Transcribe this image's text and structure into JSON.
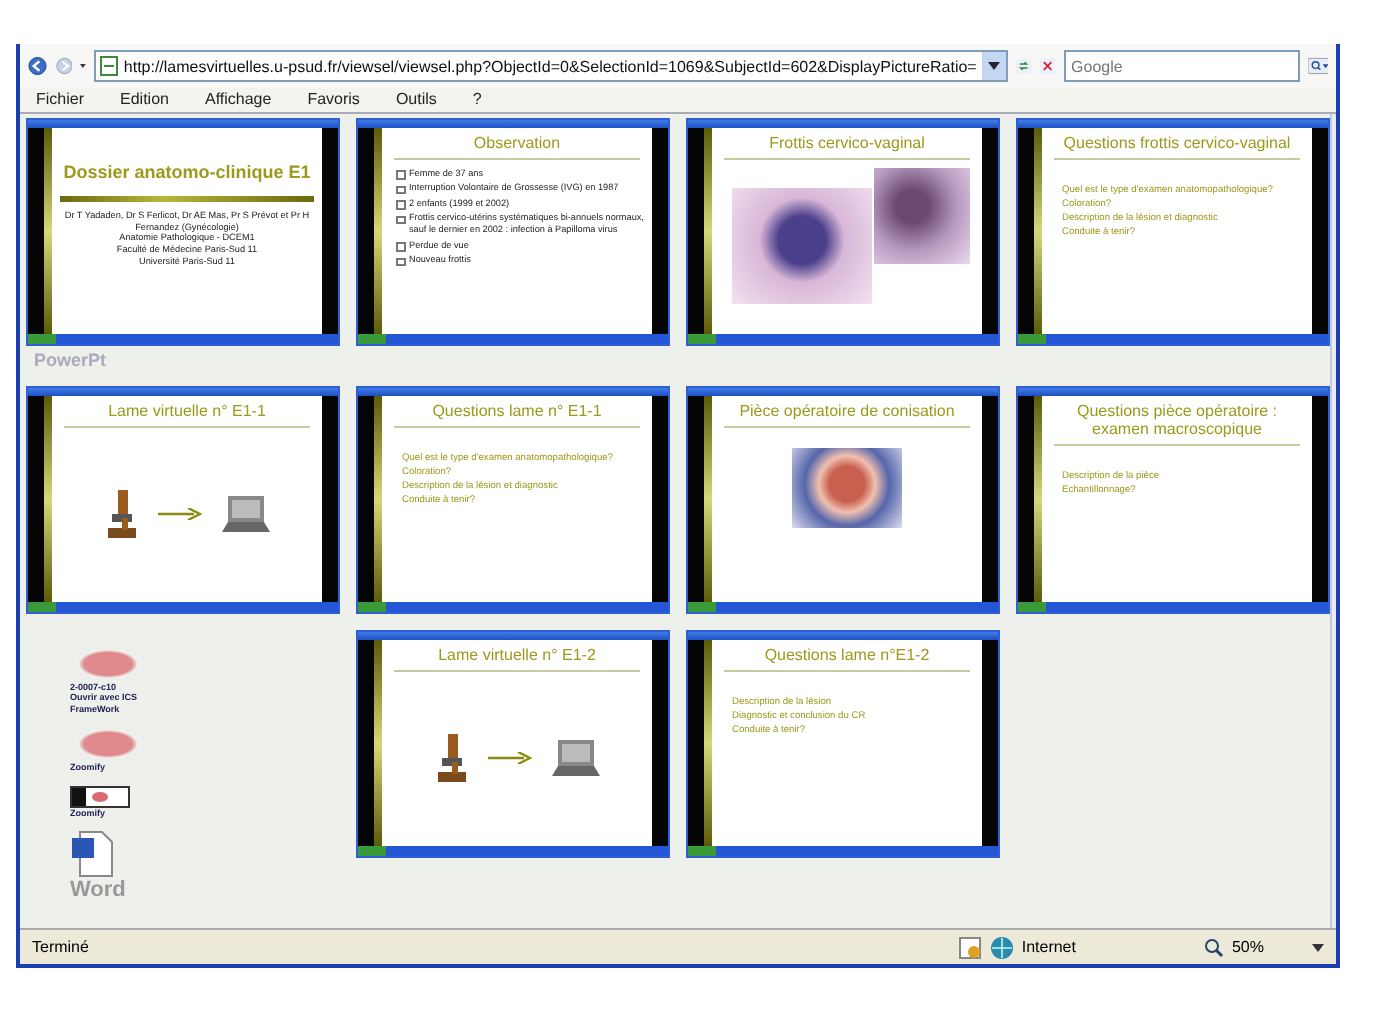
{
  "browser": {
    "address": "http://lamesvirtuelles.u-psud.fr/viewsel/viewsel.php?ObjectId=0&SelectionId=1069&SubjectId=602&DisplayPictureRatio=",
    "search": {
      "placeholder": "Google"
    },
    "menu": [
      "Fichier",
      "Edition",
      "Affichage",
      "Favoris",
      "Outils",
      "?"
    ]
  },
  "rows": [
    [
      {
        "kind": "slide",
        "caption": "PowerPt",
        "slide": {
          "kind": "title",
          "title": "Dossier anatomo-clinique E1",
          "lines": [
            "Dr T Yadaden, Dr S Ferlicot, Dr AE Mas, Pr S Prévot et Pr H Fernandez (Gynécologie)",
            "Anatomie Pathologique - DCEM1",
            "Faculté de Médecine Paris-Sud 11",
            "Université Paris-Sud 11"
          ]
        }
      },
      {
        "kind": "slide",
        "slide": {
          "kind": "bullets",
          "title": "Observation",
          "lines": [
            "Femme de 37 ans",
            "Interruption Volontaire de Grossesse (IVG) en 1987",
            "2 enfants (1999 et 2002)",
            "Frottis cervico-utérins systématiques bi-annuels normaux, sauf le dernier en 2002 : infection à Papilloma virus",
            "Perdue de vue",
            "Nouveau frottis"
          ]
        }
      },
      {
        "kind": "slide",
        "slide": {
          "kind": "smears",
          "title": "Frottis cervico-vaginal"
        }
      },
      {
        "kind": "slide",
        "slide": {
          "kind": "questions",
          "title": "Questions frottis cervico-vaginal",
          "lines": [
            "Quel est le type d'examen anatomopathologique?",
            "Coloration?",
            "Description de la lésion et diagnostic",
            "Conduite à tenir?"
          ]
        }
      }
    ],
    [
      {
        "kind": "slide",
        "slide": {
          "kind": "microscope",
          "title": "Lame virtuelle n° E1-1"
        }
      },
      {
        "kind": "slide",
        "slide": {
          "kind": "questions",
          "title": "Questions lame n° E1-1",
          "lines": [
            "Quel est le type d'examen anatomopathologique?",
            "Coloration?",
            "Description de la lésion et diagnostic",
            "Conduite à tenir?"
          ]
        }
      },
      {
        "kind": "slide",
        "slide": {
          "kind": "specimen",
          "title": "Pièce opératoire de conisation"
        }
      },
      {
        "kind": "slide",
        "slide": {
          "kind": "questions",
          "title": "Questions pièce opératoire : examen macroscopique",
          "lines": [
            "Description de la pièce",
            "Echantillonnage?"
          ]
        }
      }
    ],
    [
      {
        "kind": "links",
        "items": [
          {
            "kind": "tissue",
            "lines": [
              "2-0007-c10",
              "Ouvrir avec ICS",
              "FrameWork"
            ]
          },
          {
            "kind": "tissue",
            "lines": [
              "Zoomify"
            ]
          },
          {
            "kind": "glass",
            "lines": [
              "Zoomify"
            ]
          },
          {
            "kind": "word",
            "lines": [
              "Word"
            ]
          }
        ]
      },
      {
        "kind": "slide",
        "slide": {
          "kind": "microscope",
          "title": "Lame virtuelle n° E1-2"
        }
      },
      {
        "kind": "slide",
        "slide": {
          "kind": "questions",
          "title": "Questions lame n°E1-2",
          "lines": [
            "Description de la lésion",
            "Diagnostic et conclusion du CR",
            "Conduite à tenir?"
          ]
        }
      }
    ]
  ],
  "status_bar": {
    "text": "Terminé",
    "zone": "Internet",
    "zoom": "50%"
  }
}
